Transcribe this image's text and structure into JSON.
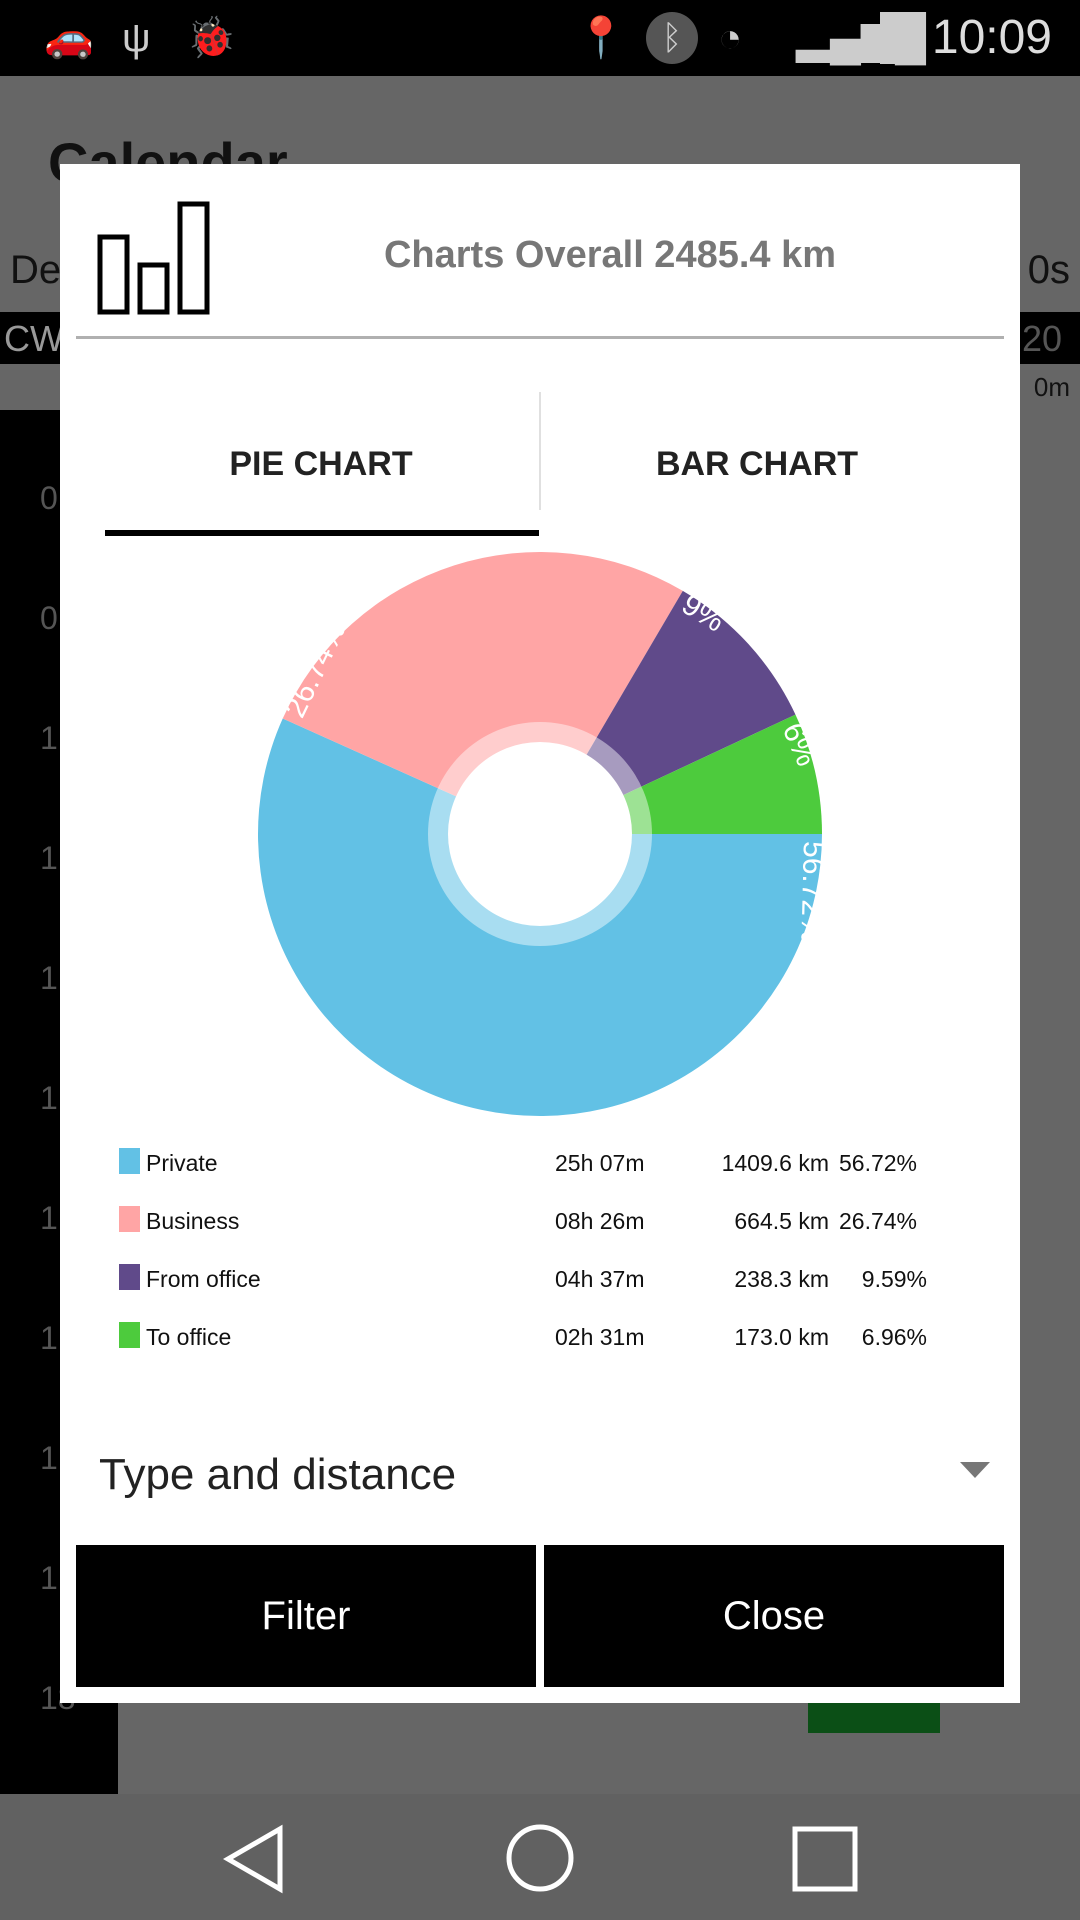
{
  "status_bar": {
    "time": "10:09",
    "icons": [
      "car-icon",
      "usb-icon",
      "bug-icon",
      "location-icon",
      "bluetooth-icon",
      "wifi-icon",
      "signal-icon",
      "battery-charging-icon"
    ]
  },
  "background_app": {
    "title": "Calendar",
    "left_text": "De",
    "right_text": "0s",
    "cw": "CW",
    "cw_right": "20",
    "row_right": "0m",
    "hours": [
      "0",
      "0",
      "1",
      "1",
      "1",
      "1",
      "1",
      "1",
      "1",
      "1",
      "18"
    ]
  },
  "dialog": {
    "icon": "bar-chart-icon",
    "title": "Charts Overall 2485.4 km",
    "tabs": [
      {
        "label": "PIE CHART",
        "selected": true
      },
      {
        "label": "BAR CHART",
        "selected": false
      }
    ],
    "legend": [
      {
        "label": "Private",
        "time": "25h 07m",
        "distance": "1409.6 km",
        "percent": "56.72%"
      },
      {
        "label": "Business",
        "time": "08h 26m",
        "distance": "664.5 km",
        "percent": "26.74%"
      },
      {
        "label": "From office",
        "time": "04h 37m",
        "distance": "238.3 km",
        "percent": "9.59%"
      },
      {
        "label": "To office",
        "time": "02h 31m",
        "distance": "173.0 km",
        "percent": "6.96%"
      }
    ],
    "select_value": "Type and distance",
    "buttons": {
      "filter": "Filter",
      "close": "Close"
    }
  },
  "chart_data": {
    "type": "pie",
    "donut": true,
    "categories": [
      "Private",
      "Business",
      "From office",
      "To office"
    ],
    "values": [
      56.72,
      26.74,
      9.59,
      6.96
    ],
    "slice_labels": [
      "56.72%",
      "26.74%",
      "9%",
      "6%"
    ],
    "colors": [
      "#62C1E5",
      "#FFA5A5",
      "#604A8A",
      "#4DCB3D"
    ]
  }
}
